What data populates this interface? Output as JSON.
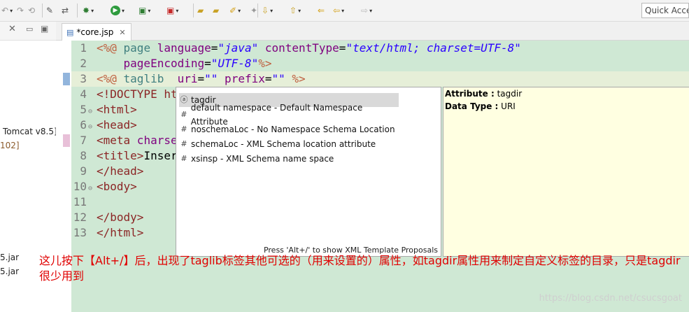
{
  "toolbar": {
    "quick_access": "Quick Acce"
  },
  "left_panel": {
    "items": [
      {
        "label": "Tomcat v8.5]"
      },
      {
        "label": "102]"
      },
      {
        "label": "5.jar"
      },
      {
        "label": "5.jar"
      }
    ]
  },
  "editor": {
    "tab_label": "*core.jsp",
    "lines": [
      {
        "n": "1"
      },
      {
        "n": "2"
      },
      {
        "n": "3"
      },
      {
        "n": "4"
      },
      {
        "n": "5"
      },
      {
        "n": "6"
      },
      {
        "n": "7"
      },
      {
        "n": "8"
      },
      {
        "n": "9"
      },
      {
        "n": "10"
      },
      {
        "n": "11"
      },
      {
        "n": "12"
      },
      {
        "n": "13"
      }
    ],
    "code": {
      "l1a": "<%@",
      "l1b": " page ",
      "l1c": "language",
      "l1d": "=",
      "l1e": "\"java\"",
      "l1f": " contentType",
      "l1g": "=",
      "l1h": "\"text/html; charset=UTF-8\"",
      "l2a": "    pageEncoding",
      "l2b": "=",
      "l2c": "\"UTF-8\"",
      "l2d": "%>",
      "l3a": "<%@",
      "l3b": " taglib  ",
      "l3c": "uri",
      "l3d": "=",
      "l3e": "\"\"",
      "l3f": " prefix",
      "l3g": "=",
      "l3h": "\"\"",
      "l3i": " %>",
      "l4": "<!DOCTYPE ht",
      "l5": "<html>",
      "l6": "<head>",
      "l7a": "<meta",
      "l7b": " charse",
      "l8a": "<title>",
      "l8b": "Inser",
      "l9": "</head>",
      "l10": "<body>",
      "l12": "</body>",
      "l13": "</html>"
    }
  },
  "popup": {
    "items": [
      {
        "icon": "a",
        "label": "tagdir"
      },
      {
        "icon": "#",
        "label": "default namespace - Default Namespace Attribute"
      },
      {
        "icon": "#",
        "label": "noschemaLoc - No Namespace Schema Location"
      },
      {
        "icon": "#",
        "label": "schemaLoc - XML Schema location attribute"
      },
      {
        "icon": "#",
        "label": "xsinsp - XML Schema name space"
      }
    ],
    "footer": "Press 'Alt+/' to show XML Template Proposals"
  },
  "info": {
    "attribute_label": "Attribute :",
    "attribute_value": " tagdir",
    "datatype_label": "Data Type :",
    "datatype_value": " URI"
  },
  "note": "这儿按下【Alt+/】后，出现了taglib标签其他可选的（用来设置的）属性，如tagdir属性用来制定自定义标签的目录，只是tagdir很少用到",
  "watermark": "https://blog.csdn.net/csucsgoat"
}
